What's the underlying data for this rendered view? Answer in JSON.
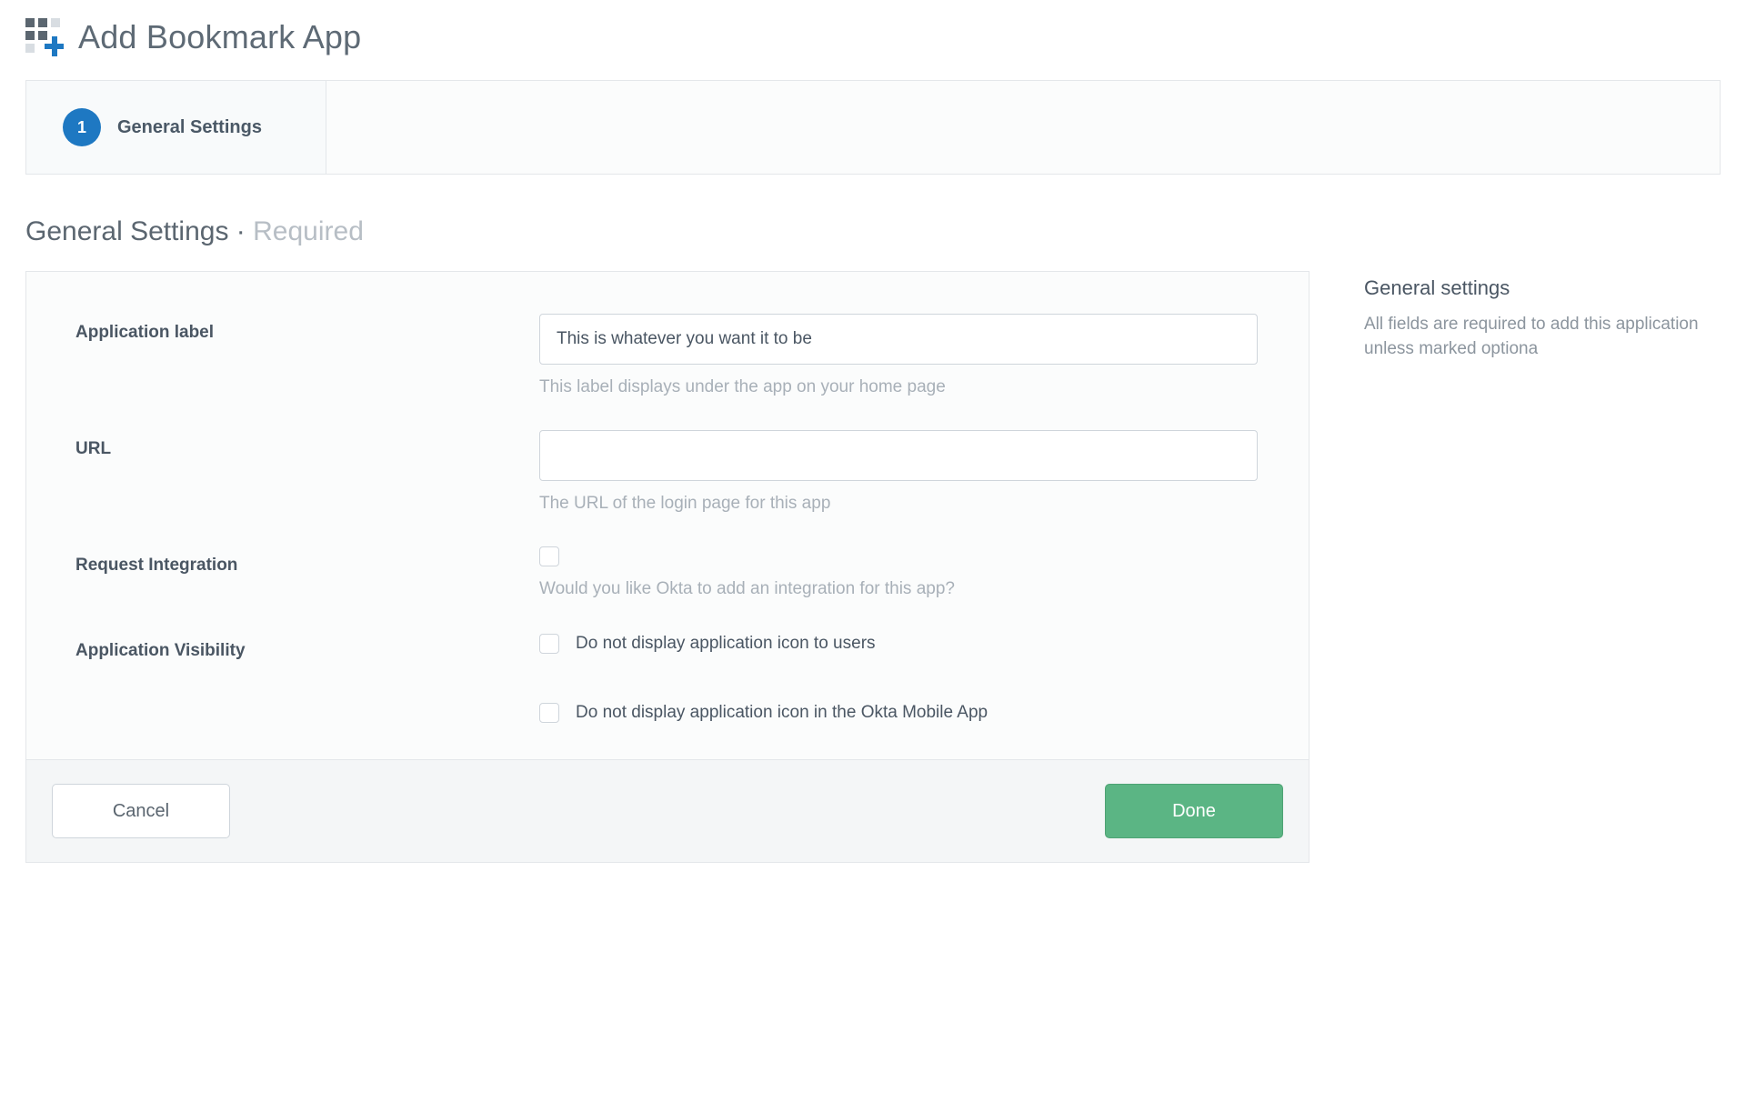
{
  "page_title": "Add Bookmark App",
  "wizard": {
    "step_number": "1",
    "step_label": "General Settings"
  },
  "section": {
    "title": "General Settings",
    "separator": " · ",
    "required": "Required"
  },
  "fields": {
    "app_label": {
      "label": "Application label",
      "value": "This is whatever you want it to be",
      "help": "This label displays under the app on your home page"
    },
    "url": {
      "label": "URL",
      "value": "",
      "help": "The URL of the login page for this app"
    },
    "request_integration": {
      "label": "Request Integration",
      "checked": false,
      "help": "Would you like Okta to add an integration for this app?"
    },
    "visibility": {
      "label": "Application Visibility",
      "opt1_label": "Do not display application icon to users",
      "opt1_checked": false,
      "opt2_label": "Do not display application icon in the Okta Mobile App",
      "opt2_checked": false
    }
  },
  "buttons": {
    "cancel": "Cancel",
    "done": "Done"
  },
  "sidebar": {
    "title": "General settings",
    "text": "All fields are required to add this application unless marked optiona"
  }
}
